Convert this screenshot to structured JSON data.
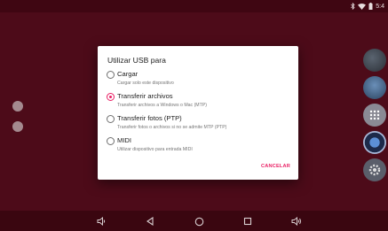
{
  "status_bar": {
    "icons": [
      "bluetooth-icon",
      "wifi-icon",
      "battery-icon"
    ],
    "time": "5:4"
  },
  "dialog": {
    "title": "Utilizar USB para",
    "selected": "transfer_files",
    "options": [
      {
        "id": "charge",
        "label": "Cargar",
        "description": "Cargar solo este dispositivo"
      },
      {
        "id": "transfer_files",
        "label": "Transferir archivos",
        "description": "Transferir archivos a Windows o Mac (MTP)"
      },
      {
        "id": "transfer_photos",
        "label": "Transferir fotos (PTP)",
        "description": "Transferir fotos o archivos si no se admite MTP (PTP)"
      },
      {
        "id": "midi",
        "label": "MIDI",
        "description": "Utilizar dispositivo para entrada MIDI"
      }
    ],
    "cancel_label": "CANCELAR"
  },
  "nav_bar": {
    "buttons": [
      "volume-down-icon",
      "back-icon",
      "home-icon",
      "recents-icon",
      "volume-up-icon"
    ]
  },
  "colors": {
    "accent": "#e91e63",
    "background": "#4d0b19"
  }
}
